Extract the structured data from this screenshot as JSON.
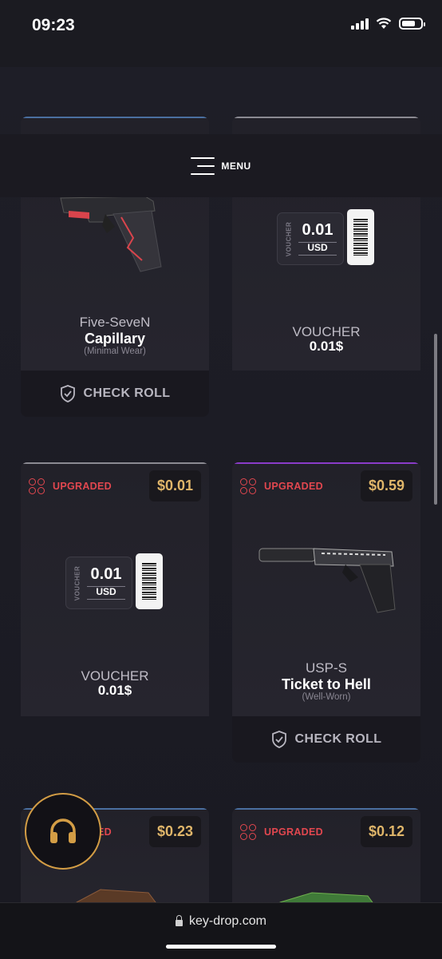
{
  "status_bar": {
    "time": "09:23"
  },
  "menu": {
    "label": "MENU"
  },
  "cards": [
    {
      "name": "Five-SeveN",
      "skin": "Capillary",
      "condition": "(Minimal Wear)",
      "check_roll": "CHECK ROLL"
    },
    {
      "name": "VOUCHER",
      "value": "0.01$",
      "voucher_amount": "0.01",
      "voucher_currency": "USD",
      "voucher_tag": "VOUCHER"
    },
    {
      "upgraded": "UPGRADED",
      "price": "$0.01",
      "name": "VOUCHER",
      "value": "0.01$",
      "voucher_amount": "0.01",
      "voucher_currency": "USD",
      "voucher_tag": "VOUCHER"
    },
    {
      "upgraded": "UPGRADED",
      "price": "$0.59",
      "name": "USP-S",
      "skin": "Ticket to Hell",
      "condition": "(Well-Worn)",
      "check_roll": "CHECK ROLL"
    },
    {
      "upgraded": "UPGRADED",
      "price": "$0.23"
    },
    {
      "upgraded": "UPGRADED",
      "price": "$0.12"
    }
  ],
  "browser": {
    "url": "key-drop.com"
  },
  "colors": {
    "accent_gold": "#e0b66a",
    "upgraded_red": "#e2474f",
    "support_ring": "#d39d45"
  }
}
